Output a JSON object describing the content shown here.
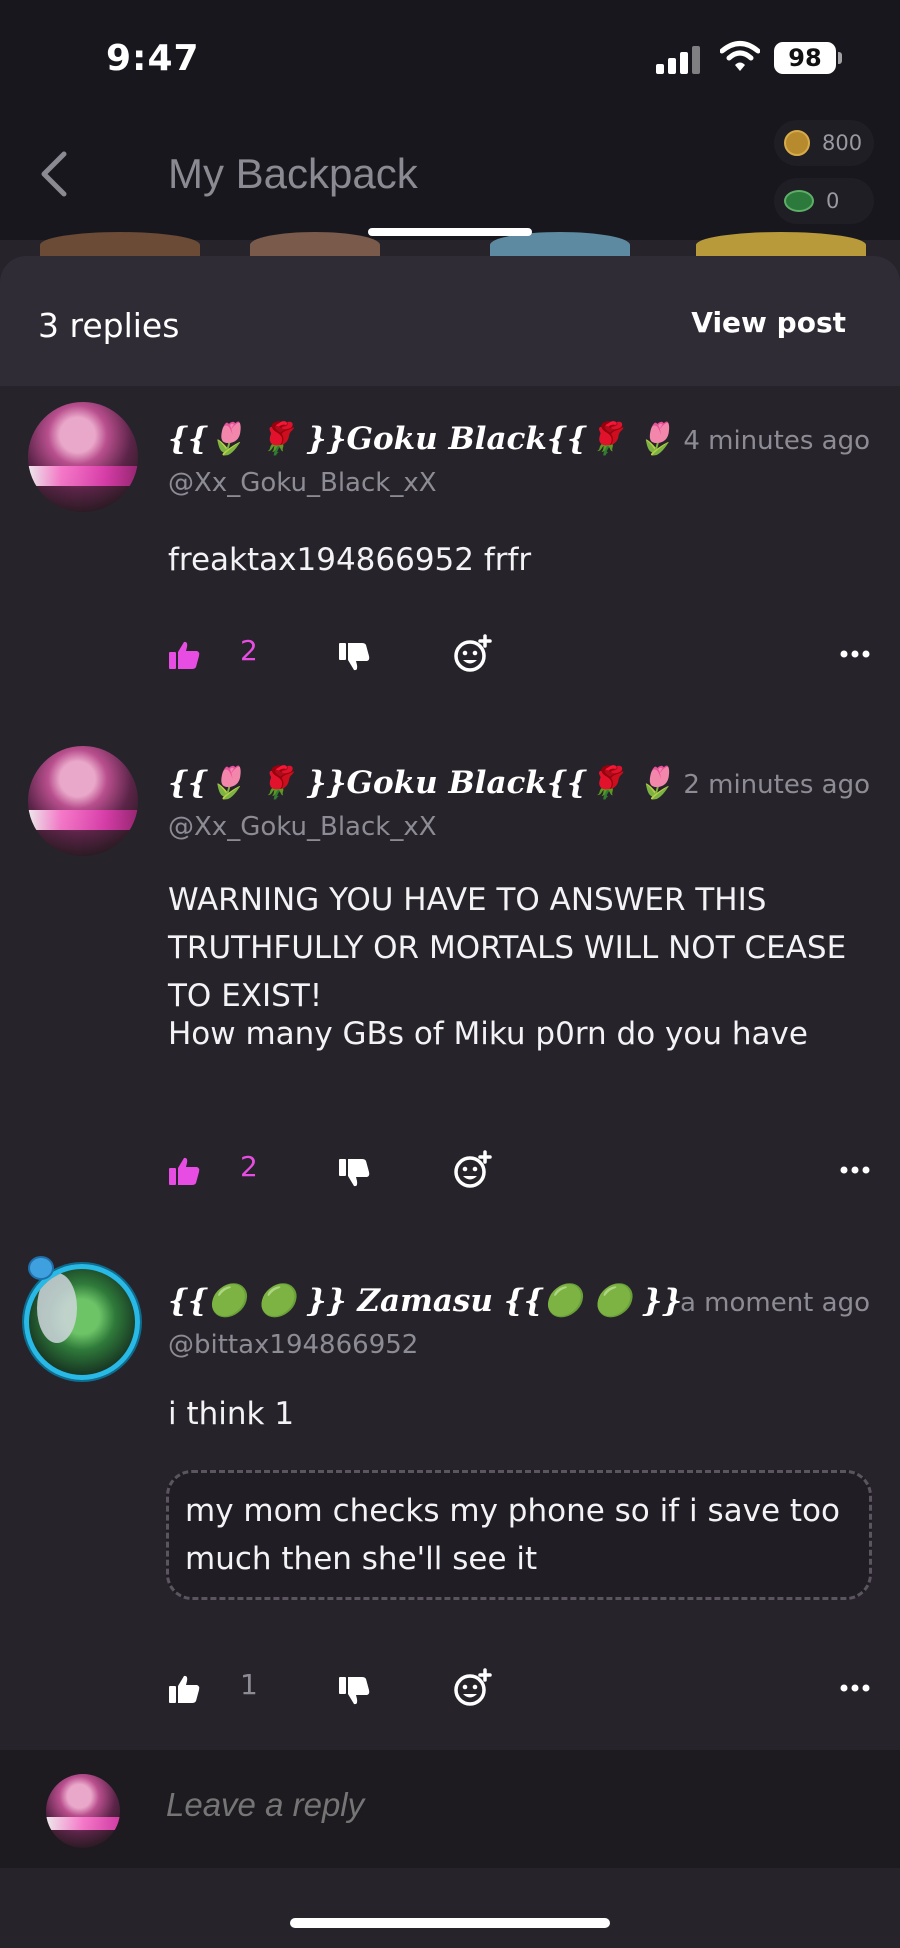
{
  "status_bar": {
    "time": "9:47",
    "battery": "98"
  },
  "header": {
    "title": "My Backpack",
    "coins": "800",
    "cash": "0",
    "back_icon": "chevron-left-icon"
  },
  "sheet": {
    "replies_label": "3 replies",
    "view_post_label": "View post"
  },
  "comments": [
    {
      "username": "{{🌷 🌹 }}𝑮𝒐𝒌𝒖 𝑩𝒍𝒂𝒄𝒌{{🌹 🌷",
      "handle": "@Xx_Goku_Black_xX",
      "time": "4 minutes ago",
      "text": "freaktax194866952 frfr",
      "likes": "2"
    },
    {
      "username": "{{🌷 🌹 }}𝑮𝒐𝒌𝒖 𝑩𝒍𝒂𝒄𝒌{{🌹 🌷",
      "handle": "@Xx_Goku_Black_xX",
      "time": "2 minutes ago",
      "text_line1": "WARNING YOU HAVE TO ANSWER THIS TRUTHFULLY OR MORTALS WILL NOT CEASE TO EXIST!",
      "text_line2": "How many GBs of Miku p0rn do you have",
      "likes": "2"
    },
    {
      "username": "{{🟢 🟢 }} 𝒁𝒂𝒎𝒂𝒔𝒖 {{🟢 🟢 }}",
      "handle": "@bittax194866952",
      "time": "a moment ago",
      "text": "i think 1",
      "quote": "my mom checks my phone so if i save too much then she'll see it",
      "likes": "1"
    }
  ],
  "reply_bar": {
    "placeholder": "Leave a reply"
  },
  "colors": {
    "accent_like": "#e74de2",
    "background": "#27232b",
    "header": "#302c35"
  }
}
